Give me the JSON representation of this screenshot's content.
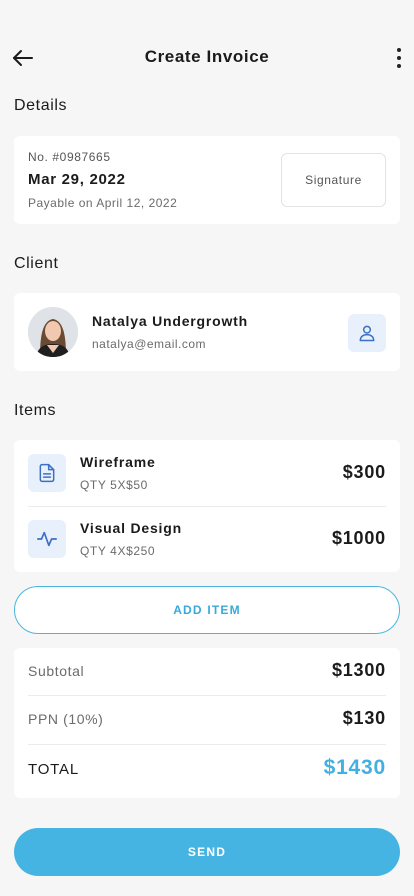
{
  "header": {
    "title": "Create Invoice"
  },
  "details": {
    "section_title": "Details",
    "invoice_no": "No. #0987665",
    "date": "Mar 29, 2022",
    "payable": "Payable on April 12, 2022",
    "signature_label": "Signature"
  },
  "client": {
    "section_title": "Client",
    "name": "Natalya Undergrowth",
    "email": "natalya@email.com"
  },
  "items": {
    "section_title": "Items",
    "list": [
      {
        "name": "Wireframe",
        "qty": "QTY 5X$50",
        "price": "$300",
        "icon": "document-icon"
      },
      {
        "name": "Visual Design",
        "qty": "QTY 4X$250",
        "price": "$1000",
        "icon": "activity-icon"
      }
    ],
    "add_label": "ADD ITEM"
  },
  "summary": {
    "subtotal_label": "Subtotal",
    "subtotal_value": "$1300",
    "tax_label": "PPN (10%)",
    "tax_value": "$130",
    "total_label": "TOTAL",
    "total_value": "$1430"
  },
  "actions": {
    "send_label": "SEND"
  },
  "colors": {
    "accent": "#46b4e2",
    "icon_bg": "#e8f0fb",
    "icon_stroke": "#3d6fc4"
  }
}
